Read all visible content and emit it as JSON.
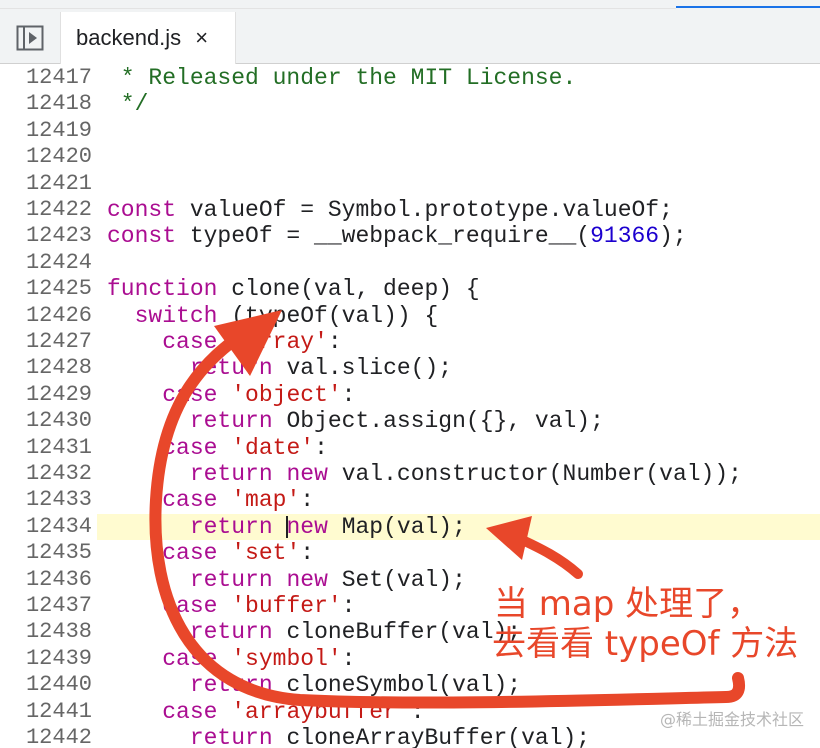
{
  "tabbar": {
    "tab_label": "backend.js",
    "close_glyph": "×",
    "toggle_icon": "sidebar-toggle-icon",
    "accent_color": "#1a73e8"
  },
  "code": {
    "highlight_line": "12434",
    "colors": {
      "comment": "#236e25",
      "keyword": "#aa0d91",
      "string": "#c41a16",
      "number": "#1c00cf",
      "highlight": "#fffbd0"
    },
    "lines": [
      {
        "n": "12417",
        "t": " * Released under the MIT License."
      },
      {
        "n": "12418",
        "t": " */"
      },
      {
        "n": "12419",
        "t": ""
      },
      {
        "n": "12420",
        "t": ""
      },
      {
        "n": "12421",
        "t": ""
      },
      {
        "n": "12422",
        "t": "const valueOf = Symbol.prototype.valueOf;"
      },
      {
        "n": "12423",
        "t": "const typeOf = __webpack_require__(91366);"
      },
      {
        "n": "12424",
        "t": ""
      },
      {
        "n": "12425",
        "t": "function clone(val, deep) {"
      },
      {
        "n": "12426",
        "t": "  switch (typeOf(val)) {"
      },
      {
        "n": "12427",
        "t": "    case 'array':"
      },
      {
        "n": "12428",
        "t": "      return val.slice();"
      },
      {
        "n": "12429",
        "t": "    case 'object':"
      },
      {
        "n": "12430",
        "t": "      return Object.assign({}, val);"
      },
      {
        "n": "12431",
        "t": "    case 'date':"
      },
      {
        "n": "12432",
        "t": "      return new val.constructor(Number(val));"
      },
      {
        "n": "12433",
        "t": "    case 'map':"
      },
      {
        "n": "12434",
        "t": "      return new Map(val);"
      },
      {
        "n": "12435",
        "t": "    case 'set':"
      },
      {
        "n": "12436",
        "t": "      return new Set(val);"
      },
      {
        "n": "12437",
        "t": "    case 'buffer':"
      },
      {
        "n": "12438",
        "t": "      return cloneBuffer(val);"
      },
      {
        "n": "12439",
        "t": "    case 'symbol':"
      },
      {
        "n": "12440",
        "t": "      return cloneSymbol(val);"
      },
      {
        "n": "12441",
        "t": "    case 'arraybuffer':"
      },
      {
        "n": "12442",
        "t": "      return cloneArrayBuffer(val);"
      }
    ]
  },
  "annotation": {
    "line1": "当 map 处理了，",
    "line2": "去看看 typeOf 方法",
    "color": "#e8472a"
  },
  "watermark": "@稀土掘金技术社区"
}
